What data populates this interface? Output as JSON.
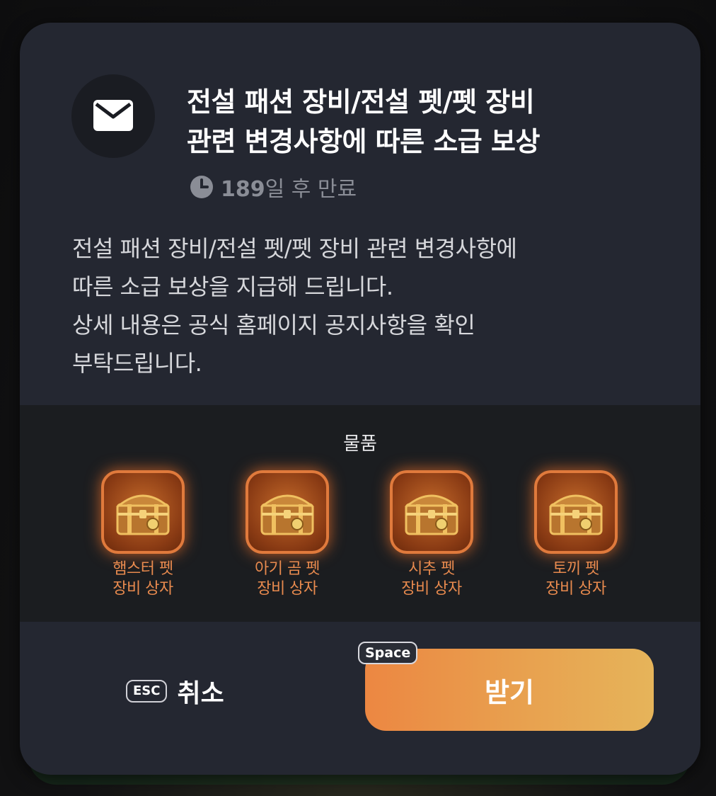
{
  "mail": {
    "title_line1": "전설 패션 장비/전설 펫/펫 장비",
    "title_line2": "관련 변경사항에 따른 소급 보상",
    "expiry_days": "189",
    "expiry_suffix": "일 후 만료",
    "body_lines": [
      "전설 패션 장비/전설 펫/펫 장비 관련 변경사항에",
      "따른 소급 보상을 지급해 드립니다.",
      "상세 내용은 공식 홈페이지 공지사항을 확인",
      "부탁드립니다."
    ]
  },
  "items": {
    "label": "물품",
    "list": [
      {
        "name_line1": "햄스터 펫",
        "name_line2": "장비 상자",
        "icon": "chest-icon"
      },
      {
        "name_line1": "아기 곰 펫",
        "name_line2": "장비 상자",
        "icon": "chest-icon"
      },
      {
        "name_line1": "시추 펫",
        "name_line2": "장비 상자",
        "icon": "chest-icon"
      },
      {
        "name_line1": "토끼 펫",
        "name_line2": "장비 상자",
        "icon": "chest-icon"
      }
    ]
  },
  "footer": {
    "cancel_key": "ESC",
    "cancel_label": "취소",
    "confirm_key": "Space",
    "confirm_label": "받기"
  },
  "colors": {
    "accent_start": "#ec8742",
    "accent_end": "#e6b45a",
    "item_border": "#e07a3c",
    "item_text": "#e88a4e",
    "panel_bg": "#242731"
  }
}
